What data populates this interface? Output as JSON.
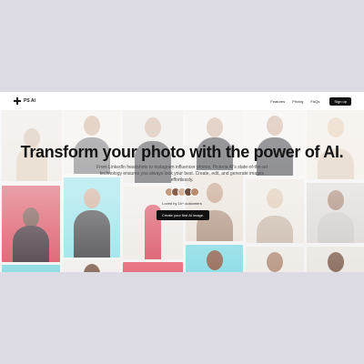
{
  "nav": {
    "brand": "PS AI",
    "links": [
      "Features",
      "Pricing",
      "FAQs"
    ],
    "signup": "Sign up"
  },
  "hero": {
    "title": "Transform your photo with the power of AI.",
    "subtitle": "From LinkedIn headshots to Instagram influencer photos, Pictoria AI's state-of-the-art technology ensures you always look your best. Create, edit, and generate images effortlessly.",
    "loved": "Loved by 1k+ customers",
    "cta": "Create your first AI image."
  },
  "colors": {
    "accent": "#111111",
    "page_bg": "#f2f1f0",
    "outer_bg": "#dcdae2"
  }
}
